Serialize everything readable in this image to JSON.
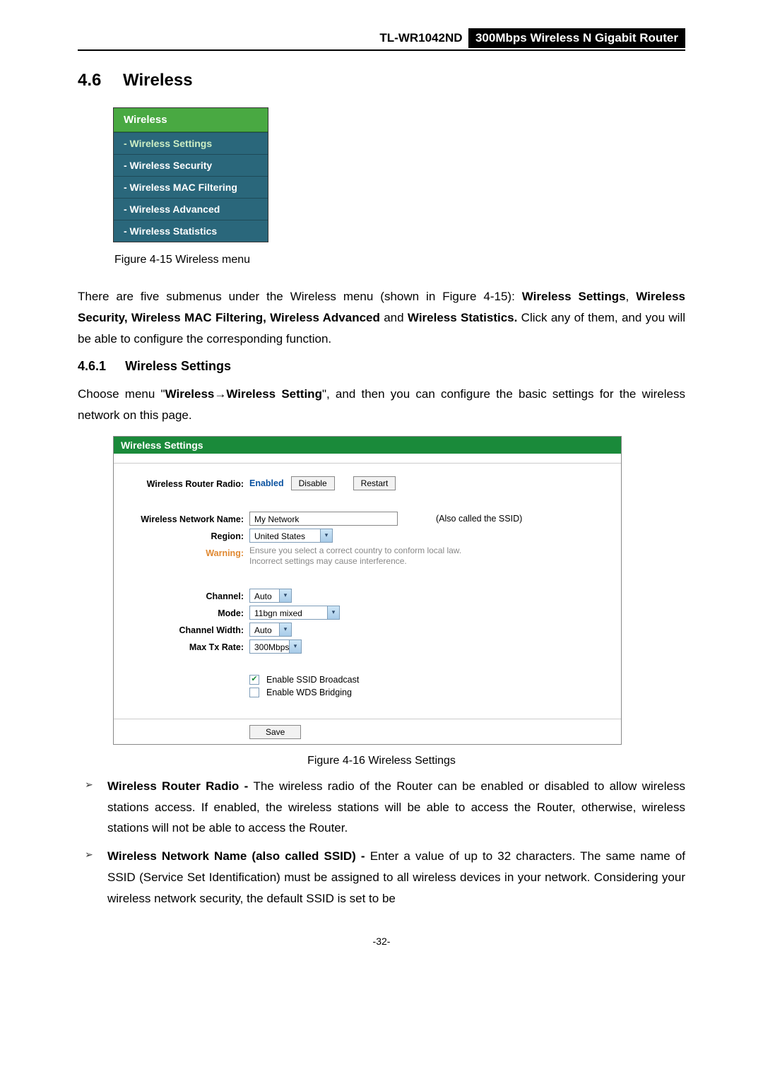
{
  "header": {
    "model": "TL-WR1042ND",
    "product": "300Mbps Wireless N Gigabit Router"
  },
  "section": {
    "number": "4.6",
    "title": "Wireless"
  },
  "menu": {
    "header": "Wireless",
    "items": [
      "- Wireless Settings",
      "- Wireless Security",
      "- Wireless MAC Filtering",
      "- Wireless Advanced",
      "- Wireless Statistics"
    ]
  },
  "captions": {
    "fig15": "Figure 4-15    Wireless menu",
    "fig16": "Figure 4-16    Wireless Settings"
  },
  "paragraphs": {
    "intro_pre": "There are five submenus under the Wireless menu (shown in ",
    "intro_figref": "Figure 4-15",
    "intro_mid": "): ",
    "intro_bold1": "Wireless Settings",
    "intro_sep": ", ",
    "intro_bold2": "Wireless Security, Wireless MAC Filtering, Wireless Advanced",
    "intro_and": " and ",
    "intro_bold3": "Wireless Statistics.",
    "intro_tail": " Click any of them, and you will be able to configure the corresponding function.",
    "choose_pre": "Choose menu \"",
    "choose_b1": "Wireless",
    "choose_arrow": "→",
    "choose_b2": "Wireless Setting",
    "choose_tail": "\", and then you can configure the basic settings for the wireless network on this page."
  },
  "subsection": {
    "number": "4.6.1",
    "title": "Wireless Settings"
  },
  "panel": {
    "title": "Wireless Settings",
    "radio_label": "Wireless Router Radio:",
    "radio_enabled": "Enabled",
    "radio_disable": "Disable",
    "radio_restart": "Restart",
    "net_name_label": "Wireless Network Name:",
    "net_name_value": "My Network",
    "net_name_note": "(Also called the SSID)",
    "region_label": "Region:",
    "region_value": "United States",
    "warning_label": "Warning:",
    "warning_text1": "Ensure you select a correct country to conform local law.",
    "warning_text2": "Incorrect settings may cause interference.",
    "channel_label": "Channel:",
    "channel_value": "Auto",
    "mode_label": "Mode:",
    "mode_value": "11bgn mixed",
    "chwidth_label": "Channel Width:",
    "chwidth_value": "Auto",
    "maxtx_label": "Max Tx Rate:",
    "maxtx_value": "300Mbps",
    "ssid_broadcast": "Enable SSID Broadcast",
    "wds": "Enable WDS Bridging",
    "save": "Save"
  },
  "desc": {
    "d1_title": "Wireless Router Radio - ",
    "d1_body": "The wireless radio of the Router can be enabled or disabled to allow wireless stations access. If enabled, the wireless stations will be able to access the Router, otherwise, wireless stations will not be able to access the Router.",
    "d2_title": "Wireless Network Name (also called SSID) - ",
    "d2_body": "Enter a value of up to 32 characters. The same name of SSID (Service Set Identification) must be assigned to all wireless devices in your network. Considering your wireless network security, the default SSID is set to be"
  },
  "page_number": "-32-"
}
